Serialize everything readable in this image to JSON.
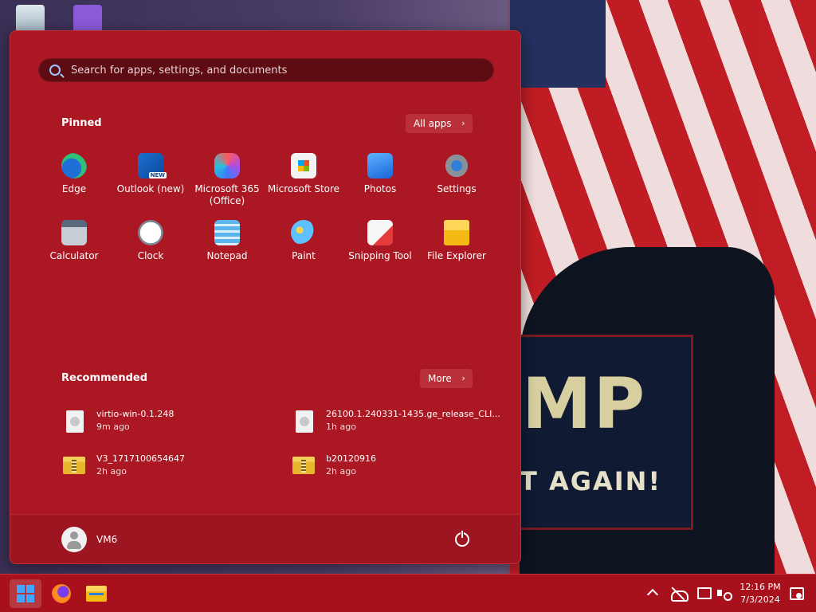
{
  "wallpaper": {
    "sign_text_large": "MP",
    "sign_text_small": "T AGAIN!"
  },
  "start_menu": {
    "search": {
      "placeholder": "Search for apps, settings, and documents",
      "value": ""
    },
    "pinned": {
      "title": "Pinned",
      "all_apps_label": "All apps",
      "apps": [
        {
          "label": "Edge",
          "icon": "edge-icon"
        },
        {
          "label": "Outlook (new)",
          "icon": "outlook-icon"
        },
        {
          "label": "Microsoft 365\n(Office)",
          "icon": "microsoft-365-icon"
        },
        {
          "label": "Microsoft Store",
          "icon": "store-icon"
        },
        {
          "label": "Photos",
          "icon": "photos-icon"
        },
        {
          "label": "Settings",
          "icon": "settings-icon"
        },
        {
          "label": "Calculator",
          "icon": "calculator-icon"
        },
        {
          "label": "Clock",
          "icon": "clock-icon"
        },
        {
          "label": "Notepad",
          "icon": "notepad-icon"
        },
        {
          "label": "Paint",
          "icon": "paint-icon"
        },
        {
          "label": "Snipping Tool",
          "icon": "snipping-tool-icon"
        },
        {
          "label": "File Explorer",
          "icon": "file-explorer-icon"
        }
      ]
    },
    "recommended": {
      "title": "Recommended",
      "more_label": "More",
      "items": [
        {
          "name": "virtio-win-0.1.248",
          "time": "9m ago",
          "icon": "disc-image-icon"
        },
        {
          "name": "26100.1.240331-1435.ge_release_CLI...",
          "time": "1h ago",
          "icon": "disc-image-icon"
        },
        {
          "name": "V3_1717100654647",
          "time": "2h ago",
          "icon": "zip-folder-icon"
        },
        {
          "name": "b20120916",
          "time": "2h ago",
          "icon": "zip-folder-icon"
        }
      ]
    },
    "user": {
      "name": "VM6"
    }
  },
  "taskbar": {
    "clock": {
      "time": "12:16 PM",
      "date": "7/3/2024"
    }
  },
  "colors": {
    "accent": "#ab1722",
    "taskbar": "#a8101c",
    "search_bg": "#5e0c12"
  }
}
